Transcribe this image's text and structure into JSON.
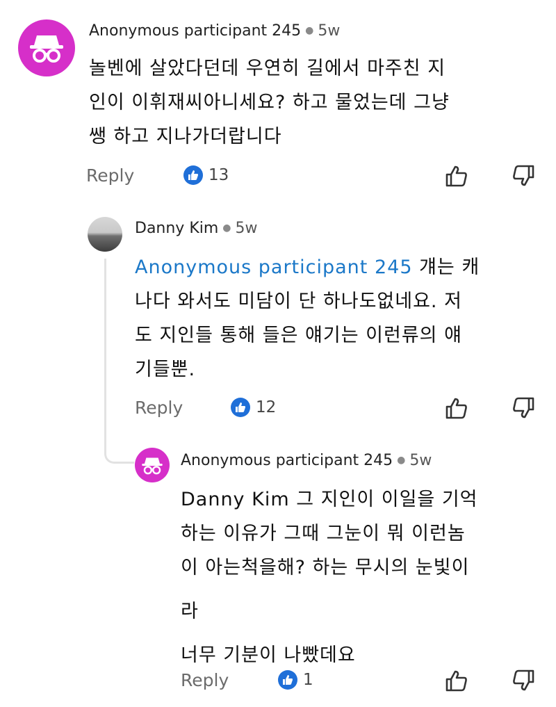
{
  "comments": [
    {
      "author": "Anonymous participant 245",
      "time": "5w",
      "text_lines": [
        "놀벤에 살았다던데 우연히 길에서 마주친 지",
        "인이 이휘재씨아니세요? 하고 물었는데 그냥",
        "쌩 하고 지나가더랍니다"
      ],
      "reply_label": "Reply",
      "like_count": "13"
    },
    {
      "author": "Danny Kim",
      "time": "5w",
      "mention": "Anonymous participant 245",
      "text_first": " 걔는 캐",
      "text_lines": [
        "나다 와서도 미담이 단 하나도없네요. 저",
        "도 지인들 통해 들은 얘기는 이런류의 얘",
        "기들뿐."
      ],
      "reply_label": "Reply",
      "like_count": "12"
    },
    {
      "author": "Anonymous participant 245",
      "time": "5w",
      "text_lines": [
        "Danny Kim 그 지인이 이일을 기억",
        "하는 이유가 그때 그눈이 뭐 이런놈",
        "이 아는척을해? 하는 무시의 눈빛이",
        "라",
        "너무 기분이 나빴데요"
      ],
      "reply_label": "Reply",
      "like_count": "1"
    }
  ],
  "icons": {
    "anonymous_avatar": "incognito-icon",
    "like_badge": "thumbs-up-icon",
    "upvote": "thumbs-up-outline-icon",
    "downvote": "thumbs-down-outline-icon"
  },
  "colors": {
    "avatar_anon": "#d62fc9",
    "like_badge": "#1f6fd8",
    "mention": "#1b78c8"
  }
}
